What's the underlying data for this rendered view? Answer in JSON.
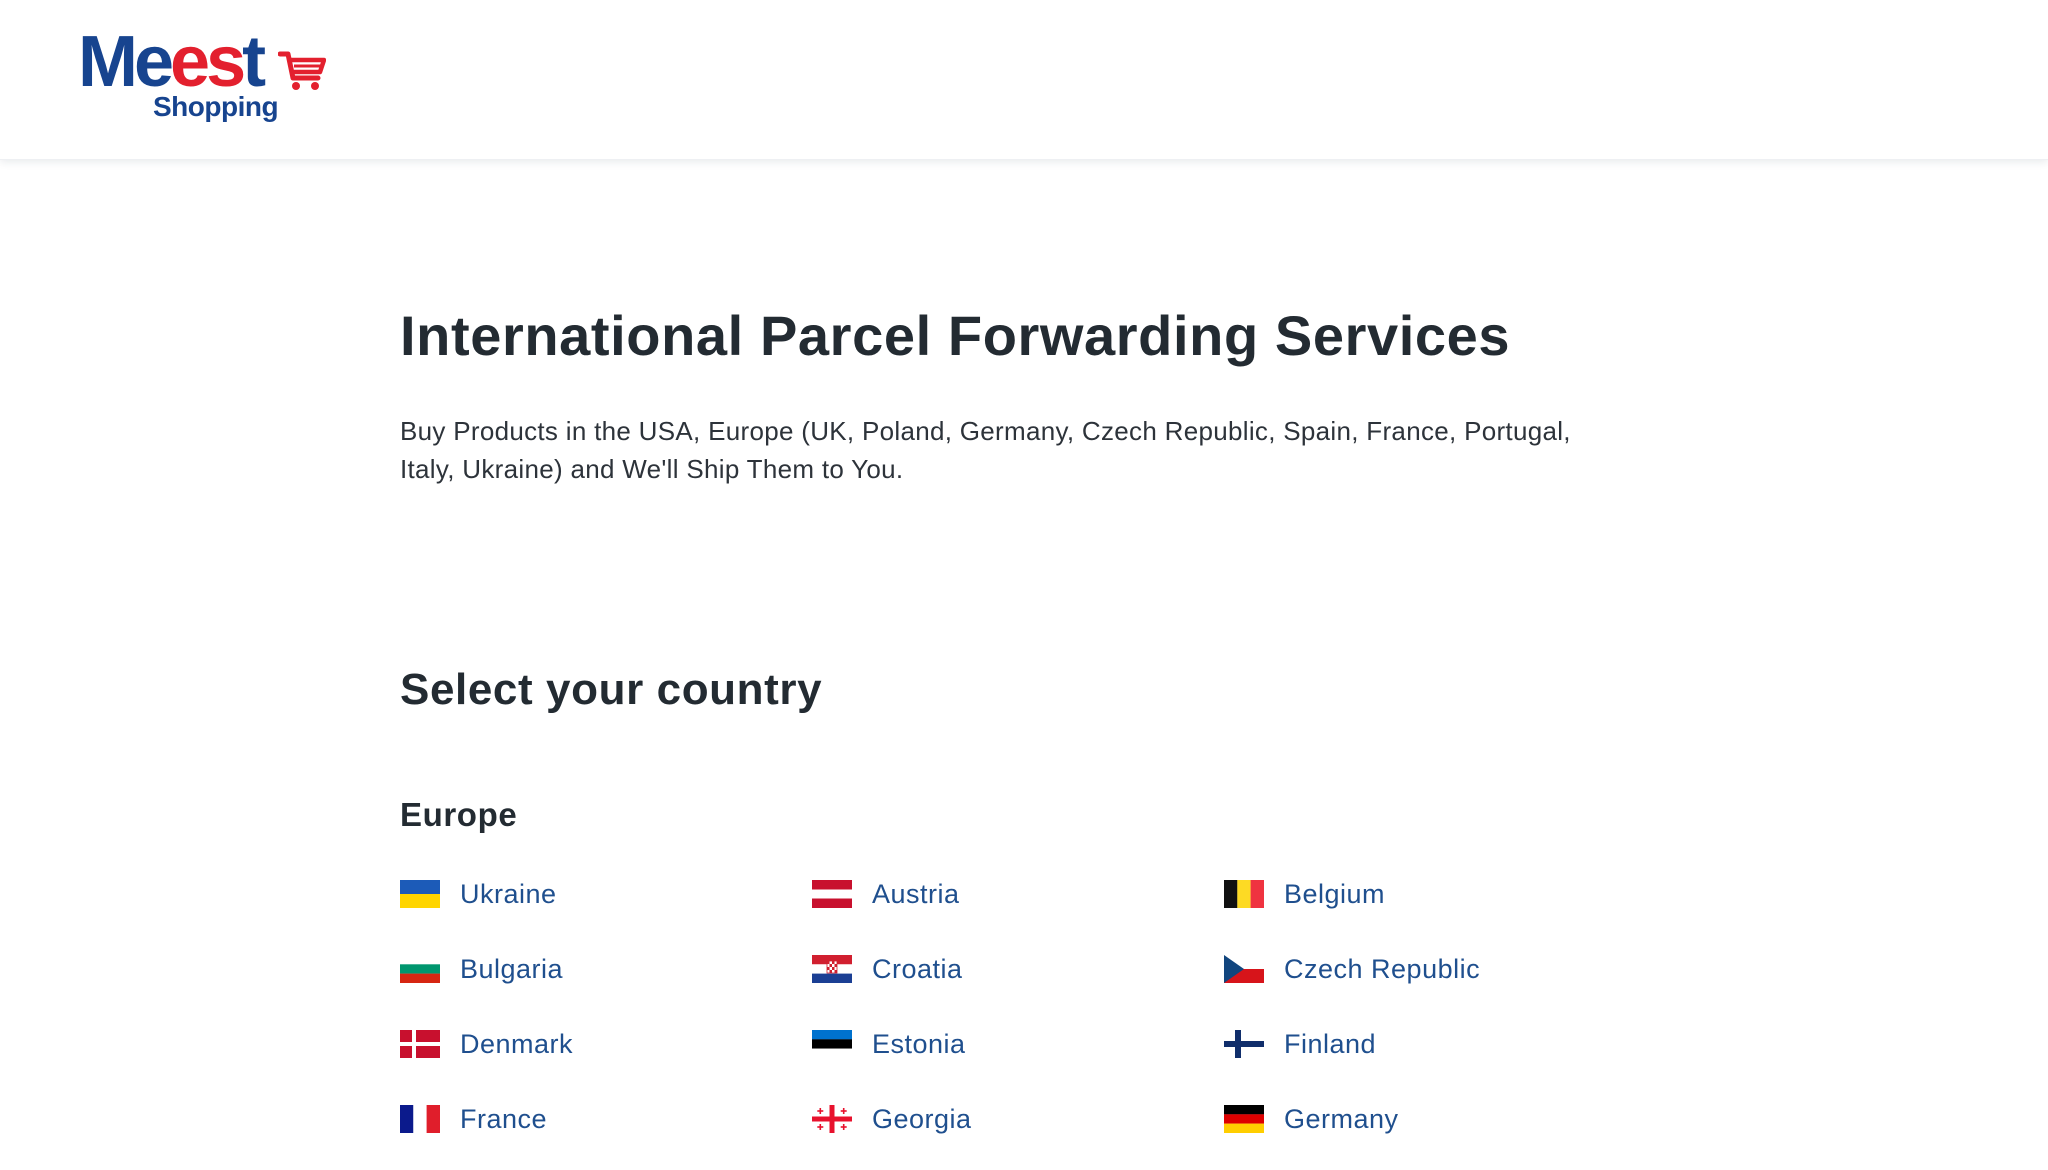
{
  "header": {
    "logo": {
      "word_main": "Meest",
      "word_accent": "",
      "sub": "Shopping"
    }
  },
  "hero": {
    "title": "International Parcel Forwarding Services",
    "subtitle": "Buy Products in the USA, Europe (UK, Poland, Germany, Czech Republic, Spain, France, Portugal, Italy, Ukraine) and We'll Ship Them to You."
  },
  "selector": {
    "heading": "Select your country",
    "region": "Europe",
    "countries": [
      {
        "name": "Ukraine",
        "flag": "flag-ukraine-icon"
      },
      {
        "name": "Austria",
        "flag": "flag-austria-icon"
      },
      {
        "name": "Belgium",
        "flag": "flag-belgium-icon"
      },
      {
        "name": "Bulgaria",
        "flag": "flag-bulgaria-icon"
      },
      {
        "name": "Croatia",
        "flag": "flag-croatia-icon"
      },
      {
        "name": "Czech Republic",
        "flag": "flag-czech-republic-icon"
      },
      {
        "name": "Denmark",
        "flag": "flag-denmark-icon"
      },
      {
        "name": "Estonia",
        "flag": "flag-estonia-icon"
      },
      {
        "name": "Finland",
        "flag": "flag-finland-icon"
      },
      {
        "name": "France",
        "flag": "flag-france-icon"
      },
      {
        "name": "Georgia",
        "flag": "flag-georgia-icon"
      },
      {
        "name": "Germany",
        "flag": "flag-germany-icon"
      }
    ]
  },
  "colors": {
    "brand_blue": "#17448f",
    "brand_red": "#e3202e",
    "link": "#1f4f8e",
    "heading": "#232b32"
  }
}
